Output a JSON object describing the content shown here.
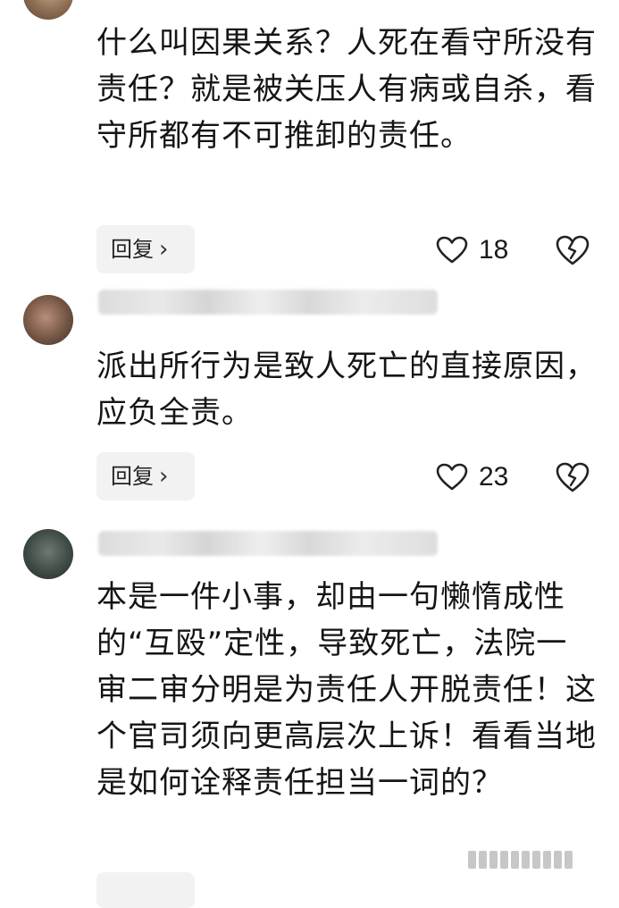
{
  "comments": [
    {
      "text": "什么叫因果关系？人死在看守所没有责任？就是被关压人有病或自杀，看守所都有不可推卸的责任。",
      "reply_label": "回复",
      "likes": "18"
    },
    {
      "text": "派出所行为是致人死亡的直接原因，应负全责。",
      "reply_label": "回复",
      "likes": "23"
    },
    {
      "text": "本是一件小事，却由一句懒惰成性的“互殴”定性，导致死亡，法院一审二审分明是为责任人开脱责任！这个官司须向更高层次上诉！看看当地是如何诠释责任担当一词的？"
    }
  ],
  "icons": {
    "like": "heart-outline-icon",
    "dislike": "broken-heart-icon",
    "reply_chevron": "chevron-right-icon"
  }
}
